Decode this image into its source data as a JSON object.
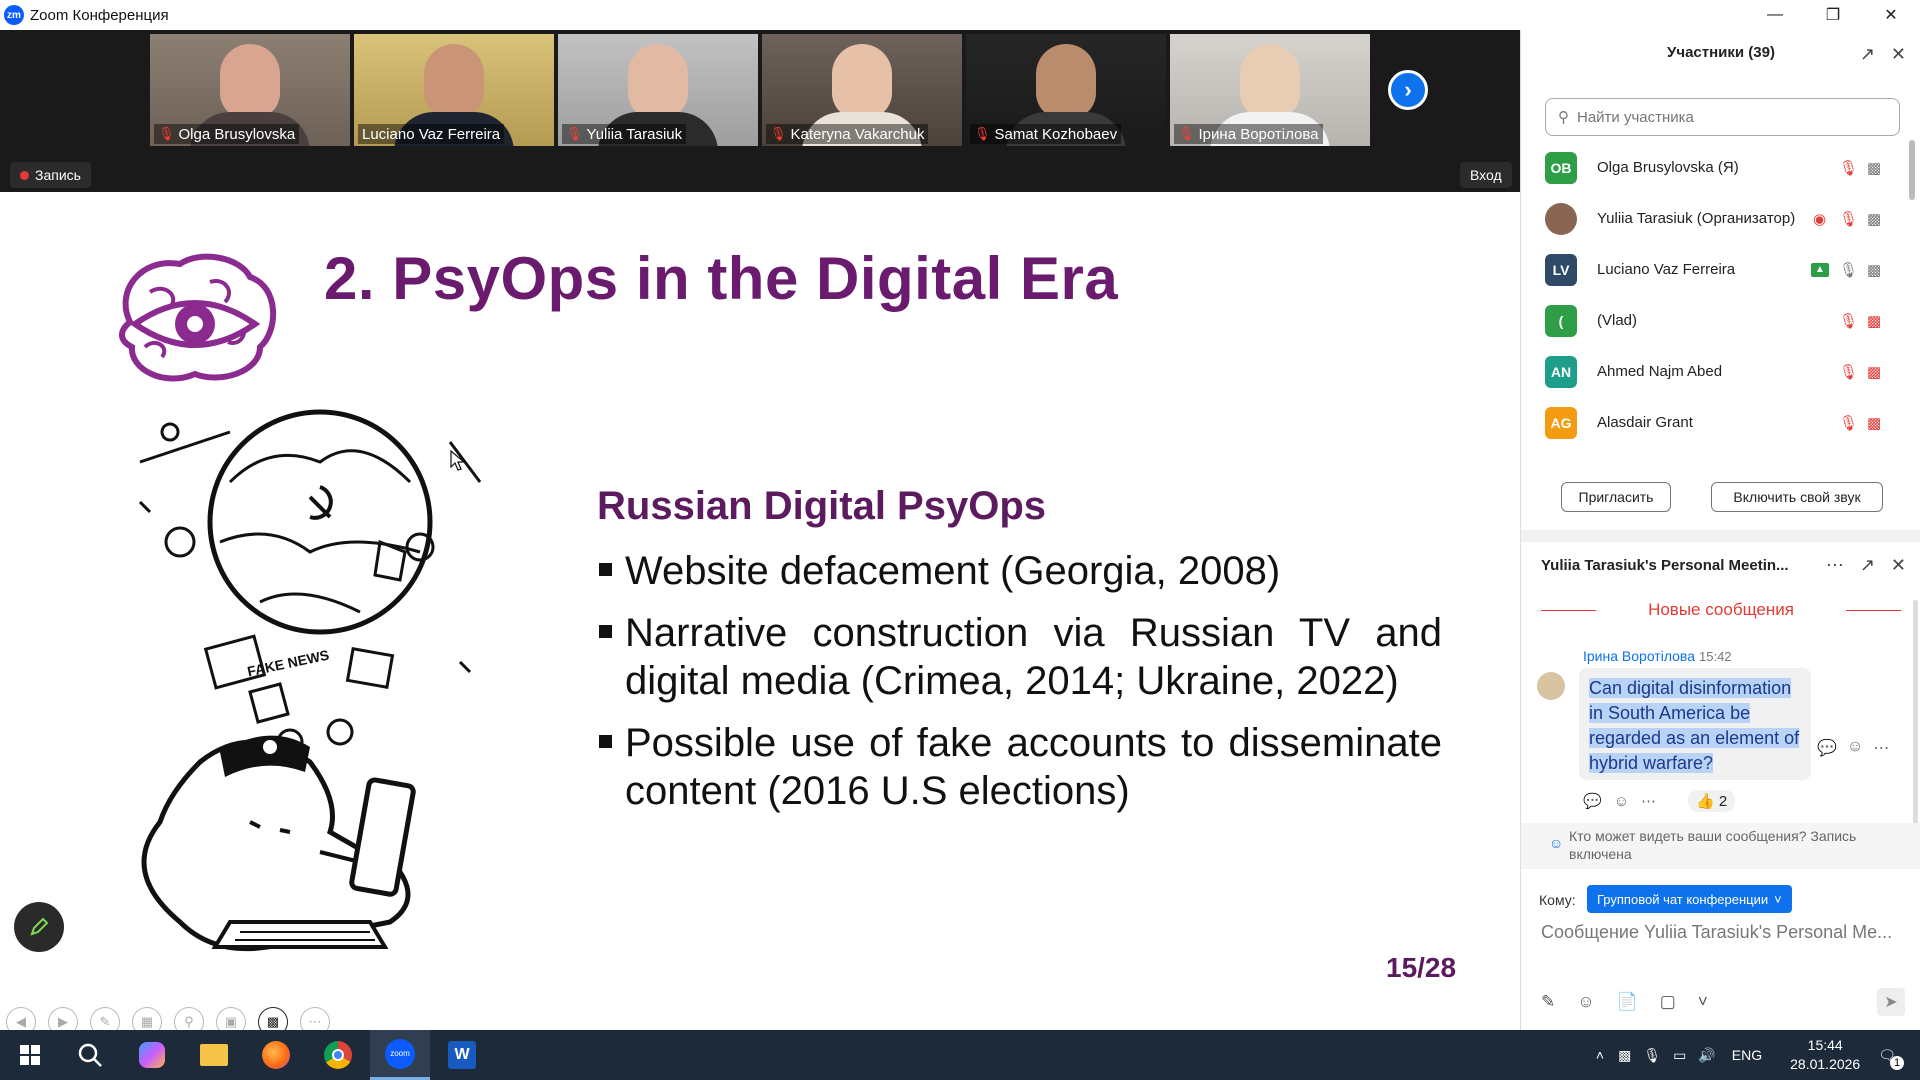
{
  "window": {
    "title": "Zoom Конференция",
    "logo_text": "zm"
  },
  "video_strip": {
    "tiles": [
      {
        "name": "Olga Brusylovska",
        "muted": true
      },
      {
        "name": "Luciano Vaz Ferreira",
        "muted": false
      },
      {
        "name": "Yuliia Tarasiuk",
        "muted": true
      },
      {
        "name": "Kateryna Vakarchuk",
        "muted": true
      },
      {
        "name": "Samat Kozhobaev",
        "muted": true
      },
      {
        "name": "Ірина Воротілова",
        "muted": true
      }
    ]
  },
  "recording_label": "Запись",
  "enter_label": "Вход",
  "slide": {
    "title": "2. PsyOps in the Digital Era",
    "subheading": "Russian Digital PsyOps",
    "bullets": [
      "Website defacement (Georgia, 2008)",
      "Narrative construction via Russian TV and digital media (Crimea, 2014; Ukraine, 2022)",
      "Possible use of fake accounts to disseminate content (2016 U.S elections)"
    ],
    "page": "15/28",
    "illustration_text": "FAKE NEWS"
  },
  "participants": {
    "header": "Участники (39)",
    "search_placeholder": "Найти участника",
    "list": [
      {
        "initials": "OB",
        "name": "Olga Brusylovska (Я)",
        "color": "#2e9e47"
      },
      {
        "initials": "",
        "name": "Yuliia Tarasiuk (Организатор)",
        "color": "#8a6552"
      },
      {
        "initials": "LV",
        "name": "Luciano Vaz Ferreira",
        "color": "#2f4a66"
      },
      {
        "initials": "(",
        "name": "(Vlad)",
        "color": "#2e9e47"
      },
      {
        "initials": "AN",
        "name": "Ahmed Najm Abed",
        "color": "#1e9e8a"
      },
      {
        "initials": "AG",
        "name": "Alasdair Grant",
        "color": "#f39c12"
      }
    ],
    "invite_label": "Пригласить",
    "unmute_label": "Включить свой звук"
  },
  "chat": {
    "title": "Yuliia Tarasiuk's Personal Meetin...",
    "new_messages": "Новые сообщения",
    "message": {
      "sender": "Ірина Воротілова",
      "time": "15:42",
      "text": "Can digital disinformation in South America be regarded as an element of hybrid warfare?",
      "reaction": "👍 2"
    },
    "visibility_note": "Кто может видеть ваши сообщения? Запись включена",
    "to_label": "Кому:",
    "to_value": "Групповой чат конференции",
    "input_placeholder": "Сообщение Yuliia Tarasiuk's Personal Me..."
  },
  "taskbar": {
    "lang": "ENG",
    "time": "15:44",
    "date": "28.01.2026",
    "notifications": "1"
  }
}
